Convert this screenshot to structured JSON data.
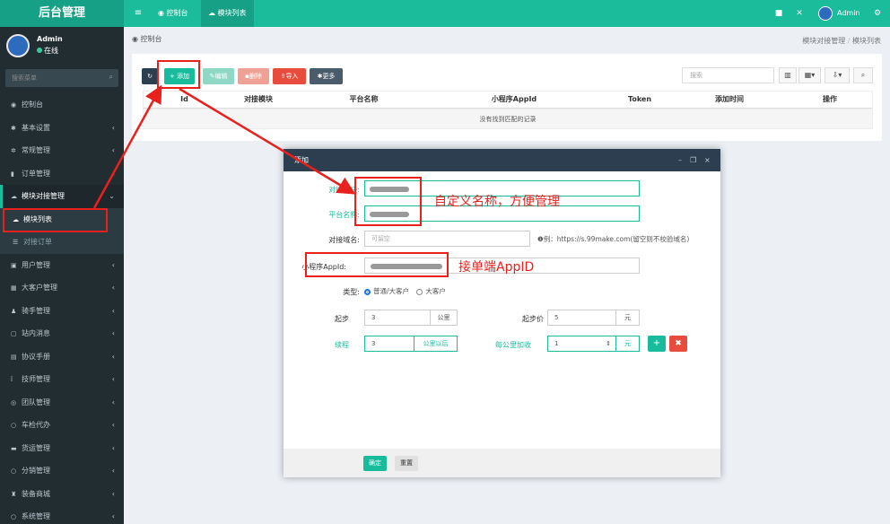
{
  "header": {
    "logo": "后台管理",
    "tabs": [
      {
        "label": "控制台",
        "icon": "dashboard-icon"
      },
      {
        "label": "模块列表",
        "icon": "cloud-icon",
        "active": true
      }
    ],
    "user": "Admin"
  },
  "sidebar": {
    "user_name": "Admin",
    "status": "在线",
    "search_placeholder": "搜索菜单",
    "items": [
      {
        "label": "控制台",
        "icon": "dashboard-icon",
        "chevron": false
      },
      {
        "label": "基本设置",
        "icon": "gear-icon",
        "chevron": true
      },
      {
        "label": "常规管理",
        "icon": "cogs-icon",
        "chevron": true
      },
      {
        "label": "订单管理",
        "icon": "file-icon",
        "chevron": true
      },
      {
        "label": "模块对接管理",
        "icon": "cloud-icon",
        "chevron": true,
        "open": true
      },
      {
        "label": "模块列表",
        "icon": "cloud-icon",
        "sub": true,
        "active": true
      },
      {
        "label": "对接订单",
        "icon": "list-icon",
        "sub": true
      },
      {
        "label": "用户管理",
        "icon": "user-icon",
        "chevron": true
      },
      {
        "label": "大客户管理",
        "icon": "building-icon",
        "chevron": true
      },
      {
        "label": "骑手管理",
        "icon": "rider-icon",
        "chevron": true
      },
      {
        "label": "站内消息",
        "icon": "message-icon",
        "chevron": true
      },
      {
        "label": "协议手册",
        "icon": "book-icon",
        "chevron": true
      },
      {
        "label": "技师管理",
        "icon": "wrench-icon",
        "chevron": true
      },
      {
        "label": "团队管理",
        "icon": "team-icon",
        "chevron": true
      },
      {
        "label": "车检代办",
        "icon": "circle-icon",
        "chevron": true
      },
      {
        "label": "货运管理",
        "icon": "truck-icon",
        "chevron": true
      },
      {
        "label": "分销管理",
        "icon": "circle-icon",
        "chevron": true
      },
      {
        "label": "装备商城",
        "icon": "shop-icon",
        "chevron": true
      },
      {
        "label": "系统管理",
        "icon": "circle-icon",
        "chevron": true
      }
    ]
  },
  "breadcrumb": {
    "current": "控制台",
    "path": [
      "模块对接管理",
      "模块列表"
    ],
    "sep": "/"
  },
  "toolbar": {
    "refresh_icon": "refresh-icon",
    "add_label": "+ 添加",
    "edit_label": "编辑",
    "delete_label": "删除",
    "import_label": "导入",
    "more_label": "更多",
    "search_placeholder": "搜索"
  },
  "table": {
    "columns": [
      "Id",
      "对接模块",
      "平台名称",
      "小程序AppId",
      "Token",
      "添加时间",
      "操作"
    ],
    "empty_text": "没有找到匹配的记录"
  },
  "modal": {
    "title": "添加",
    "fields": {
      "module_label": "对接模块:",
      "platform_label": "平台名称:",
      "platform_value_hint": "EWERWQE",
      "domain_label": "对接域名:",
      "domain_placeholder": "可留空",
      "domain_hint": "例：https://s.99make.com(留空则不校验域名)",
      "appid_label": "小程序AppId:",
      "type_label": "类型:",
      "type_options": [
        "普通/大客户",
        "大客户"
      ],
      "start_label": "起步",
      "start_value": "3",
      "start_unit": "公里",
      "start_price_label": "起步价",
      "start_price_value": "5",
      "start_price_unit": "元",
      "mileage_label": "续程",
      "mileage_value": "3",
      "mileage_unit": "公里以后",
      "per_km_label": "每公里加收",
      "per_km_value": "1",
      "per_km_unit": "元"
    },
    "confirm_label": "确定",
    "reset_label": "重置"
  },
  "annotations": {
    "custom_name": "自定义名称，方便管理",
    "appid_note": "接单端AppID"
  },
  "colors": {
    "accent": "#1abc9c",
    "sidebar": "#222d32",
    "danger": "#e74c3c",
    "annotation_red": "#e8211d"
  }
}
